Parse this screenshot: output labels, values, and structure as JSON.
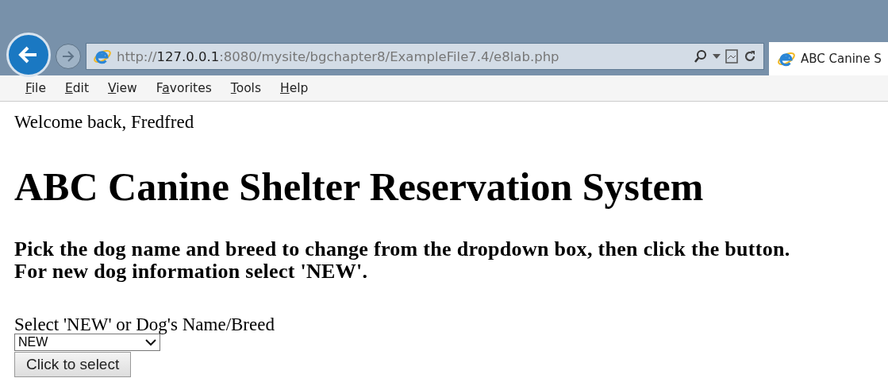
{
  "browser": {
    "url": {
      "scheme": "http://",
      "host": "127.0.0.1",
      "path": ":8080/mysite/bgchapter8/ExampleFile7.4/e8lab.php"
    },
    "tab": {
      "title": "ABC Canine S",
      "selected": true
    }
  },
  "menu": [
    {
      "key": "F",
      "rest": "ile"
    },
    {
      "key": "E",
      "rest": "dit"
    },
    {
      "key": "V",
      "rest": "iew"
    },
    {
      "lead": "F",
      "key": "a",
      "rest": "vorites"
    },
    {
      "key": "T",
      "rest": "ools"
    },
    {
      "key": "H",
      "rest": "elp"
    }
  ],
  "page": {
    "welcome": "Welcome back, Fredfred",
    "heading": "ABC Canine Shelter Reservation System",
    "instructions": [
      "Pick the dog name and breed to change from the dropdown box, then click the button.",
      "For new dog information select 'NEW'."
    ],
    "select_label": "Select 'NEW' or Dog's Name/Breed",
    "select_value": "NEW",
    "button": "Click to select"
  }
}
